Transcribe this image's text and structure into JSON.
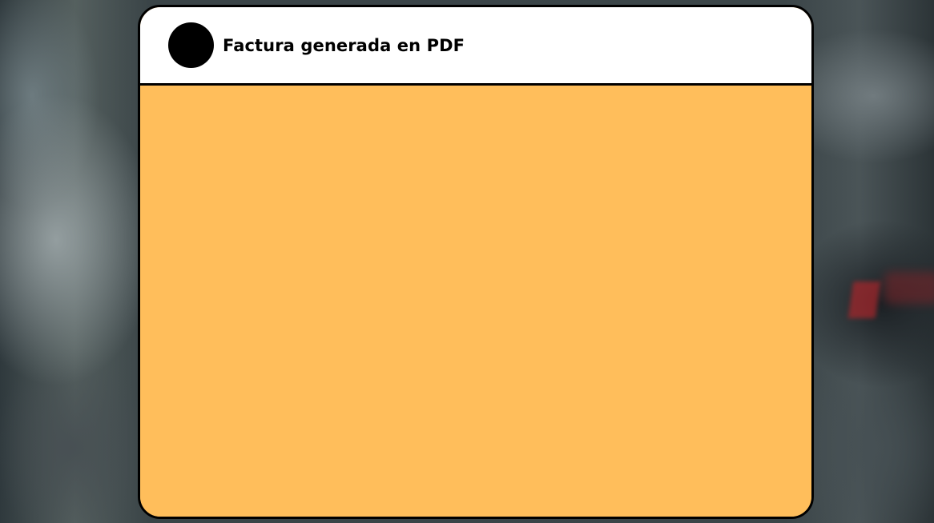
{
  "dialog": {
    "title": "Factura generada en PDF",
    "avatar_icon": "circle-avatar-icon"
  },
  "colors": {
    "header_background": "#ffffff",
    "body_background": "#ffbe5b",
    "border": "#000000",
    "avatar": "#000000"
  }
}
